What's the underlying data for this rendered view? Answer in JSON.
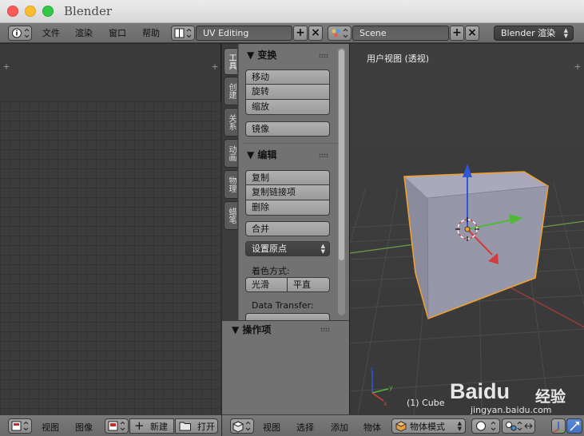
{
  "window": {
    "title": "Blender"
  },
  "info_header": {
    "menus": [
      "文件",
      "渲染",
      "窗口",
      "帮助"
    ],
    "screen_layout": "UV Editing",
    "scene": "Scene",
    "render_engine": "Blender 渲染"
  },
  "tool_shelf": {
    "tabs": [
      "工具",
      "创建",
      "关系",
      "动画",
      "物理",
      "蜡笔"
    ],
    "transform": {
      "title": "▼ 变换",
      "buttons": [
        "移动",
        "旋转",
        "缩放"
      ],
      "mirror": "镜像"
    },
    "edit": {
      "title": "▼ 编辑",
      "buttons": [
        "复制",
        "复制链接项",
        "删除"
      ],
      "join": "合并",
      "set_origin": "设置原点",
      "shading_label": "着色方式:",
      "smooth": "光滑",
      "flat": "平直",
      "data_transfer_label": "Data Transfer:"
    }
  },
  "operator_panel": {
    "title": "▼ 操作项"
  },
  "viewport": {
    "view_label": "用户视图 (透视)",
    "object_label": "(1) Cube",
    "colors": {
      "cube": "#8d8da0",
      "outline": "#f0a030",
      "x_axis": "#d23c3c",
      "y_axis": "#6fb34a",
      "z_axis": "#2e56d6"
    }
  },
  "uv_footer": {
    "menus": [
      "视图",
      "图像"
    ],
    "new": "新建",
    "open": "打开"
  },
  "view3d_footer": {
    "menus": [
      "视图",
      "选择",
      "添加",
      "物体"
    ],
    "mode": "物体模式"
  },
  "watermark": {
    "brand": "Baidu",
    "suffix": "经验",
    "url": "jingyan.baidu.com"
  }
}
